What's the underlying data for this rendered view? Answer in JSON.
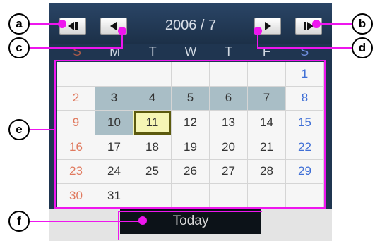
{
  "calendar": {
    "title": "2006 / 7",
    "weekdays": [
      "S",
      "M",
      "T",
      "W",
      "T",
      "F",
      "S"
    ],
    "rows": [
      [
        "",
        "",
        "",
        "",
        "",
        "",
        "1"
      ],
      [
        "2",
        "3",
        "4",
        "5",
        "6",
        "7",
        "8"
      ],
      [
        "9",
        "10",
        "11",
        "12",
        "13",
        "14",
        "15"
      ],
      [
        "16",
        "17",
        "18",
        "19",
        "20",
        "21",
        "22"
      ],
      [
        "23",
        "24",
        "25",
        "26",
        "27",
        "28",
        "29"
      ],
      [
        "30",
        "31",
        "",
        "",
        "",
        "",
        ""
      ]
    ],
    "selected_day": "11",
    "highlighted_week_days": [
      "3",
      "4",
      "5",
      "6",
      "7",
      "10"
    ],
    "today_label": "Today"
  },
  "icons": {
    "first": "skip-back-icon",
    "prev": "triangle-left-icon",
    "next": "triangle-right-icon",
    "last": "skip-forward-icon"
  },
  "callouts": {
    "a": "a",
    "b": "b",
    "c": "c",
    "d": "d",
    "e": "e",
    "f": "f"
  },
  "colors": {
    "annotation": "#ee16ee",
    "selected_outline": "#5c5a0e",
    "week_highlight": "#a9bec6",
    "sunday": "#e0795e",
    "saturday": "#3f6fd6"
  }
}
